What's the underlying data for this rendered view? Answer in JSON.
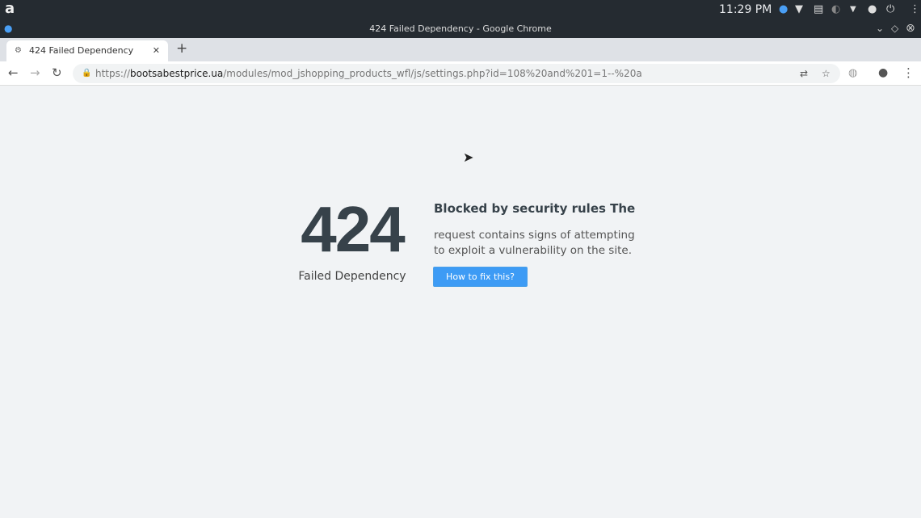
{
  "system": {
    "clock": "11:29 PM"
  },
  "window": {
    "title": "424 Failed Dependency - Google Chrome"
  },
  "tab": {
    "title": "424 Failed Dependency"
  },
  "address": {
    "scheme": "https://",
    "host": "bootsabestprice.ua",
    "path": "/modules/mod_jshopping_products_wfl/js/settings.php?id=108%20and%201=1--%20a"
  },
  "page": {
    "code": "424",
    "code_label": "Failed Dependency",
    "heading": "Blocked by security rules The",
    "description": "request contains signs of attempting to exploit a vulnerability on the site.",
    "button": "How to fix this?"
  },
  "colors": {
    "button": "#3d9bf5",
    "text": "#37424a",
    "background": "#f1f3f5"
  }
}
